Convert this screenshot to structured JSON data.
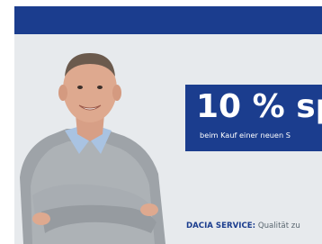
{
  "colors": {
    "brand_blue": "#1b3d8e",
    "background": "#e7eaed",
    "service_label": "#1b3d8e"
  },
  "promo": {
    "headline": "10 % sp",
    "subline": "beim Kauf einer neuen S"
  },
  "service": {
    "label": "DACIA SERVICE:",
    "tagline": "Qualität zu"
  },
  "image": {
    "subject": "man-with-crossed-arms-photo"
  }
}
